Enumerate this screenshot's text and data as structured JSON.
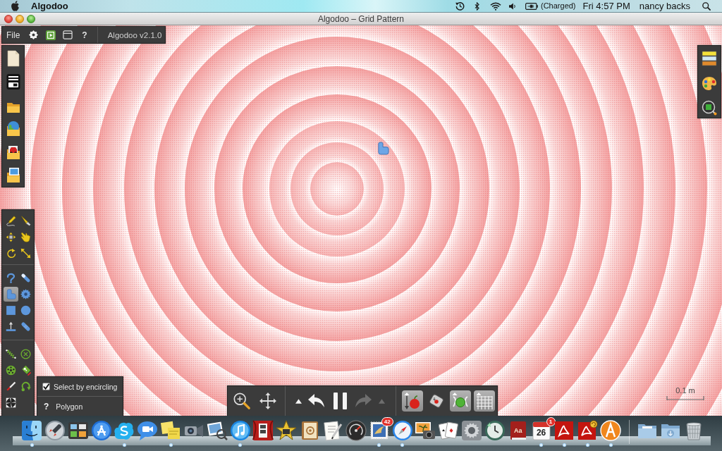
{
  "menu_bar": {
    "app_name": "Algodoo",
    "battery_status": "(Charged)",
    "clock": "Fri 4:57 PM",
    "user": "nancy backs"
  },
  "window": {
    "title": "Algodoo – Grid Pattern"
  },
  "file_bar": {
    "menu": "File",
    "help": "?",
    "version": "Algodoo v2.1.0"
  },
  "tool_palette": {
    "groups": [
      {
        "tools": [
          {
            "kind": "sketch",
            "selected": false
          },
          {
            "kind": "knife",
            "selected": false
          },
          {
            "kind": "move",
            "selected": false
          },
          {
            "kind": "drag",
            "selected": false
          },
          {
            "kind": "rotate",
            "selected": false
          },
          {
            "kind": "scale",
            "selected": false
          }
        ]
      },
      {
        "tools": [
          {
            "kind": "hook",
            "selected": false
          },
          {
            "kind": "brush",
            "selected": false
          },
          {
            "kind": "polygon",
            "selected": true
          },
          {
            "kind": "gear",
            "selected": false
          },
          {
            "kind": "box",
            "selected": false
          },
          {
            "kind": "circle",
            "selected": false
          },
          {
            "kind": "plane",
            "selected": false
          },
          {
            "kind": "capsule",
            "selected": false
          }
        ]
      },
      {
        "tools": [
          {
            "kind": "spring",
            "selected": false
          },
          {
            "kind": "axle",
            "selected": false
          },
          {
            "kind": "wheel",
            "selected": false
          },
          {
            "kind": "tag",
            "selected": false
          },
          {
            "kind": "pen",
            "selected": false
          },
          {
            "kind": "hinge",
            "selected": false
          },
          {
            "kind": "pinwheel",
            "selected": false
          }
        ]
      }
    ]
  },
  "options_panel": {
    "checkbox": {
      "label": "Select by encircling",
      "checked": true
    },
    "help": "?",
    "tool_name": "Polygon"
  },
  "simulation_bar": {
    "history": [
      {
        "kind": "caret",
        "disabled": false
      },
      {
        "kind": "undo",
        "disabled": false
      },
      {
        "kind": "pause",
        "disabled": false
      },
      {
        "kind": "redo",
        "disabled": true
      },
      {
        "kind": "caret",
        "disabled": true
      }
    ],
    "toggles": [
      {
        "kind": "gravity",
        "on": true
      },
      {
        "kind": "air",
        "on": false
      },
      {
        "kind": "collision",
        "on": true
      },
      {
        "kind": "grid",
        "on": true
      }
    ]
  },
  "scale_bar": {
    "label": "0.1 m"
  },
  "dock": {
    "items": [
      {
        "kind": "finder",
        "running": true
      },
      {
        "kind": "rocket",
        "running": false
      },
      {
        "kind": "windows",
        "running": false
      },
      {
        "kind": "appstore",
        "running": false
      },
      {
        "kind": "cloud",
        "running": true
      },
      {
        "kind": "bubble",
        "running": false
      },
      {
        "kind": "notes",
        "running": true
      },
      {
        "kind": "camera",
        "running": false
      },
      {
        "kind": "photos",
        "running": false
      },
      {
        "kind": "music",
        "running": true
      },
      {
        "kind": "booth",
        "running": false
      },
      {
        "kind": "star",
        "running": false
      },
      {
        "kind": "contacts",
        "running": false
      },
      {
        "kind": "textedit",
        "running": false
      },
      {
        "kind": "gauge",
        "running": false
      },
      {
        "kind": "stamp",
        "running": true,
        "badge": "42"
      },
      {
        "kind": "compass",
        "running": true
      },
      {
        "kind": "photocam",
        "running": false
      },
      {
        "kind": "cards",
        "running": false
      },
      {
        "kind": "gears",
        "running": false
      },
      {
        "kind": "clock",
        "running": false
      },
      {
        "kind": "dictionary",
        "running": false,
        "label": "Aa"
      },
      {
        "kind": "calendar",
        "running": true,
        "label": "26",
        "badge": "1"
      },
      {
        "kind": "swoosh",
        "running": true
      },
      {
        "kind": "swooshsync",
        "running": true
      },
      {
        "kind": "ashape",
        "running": true
      }
    ],
    "stacks": [
      {
        "kind": "folder",
        "running": false
      },
      {
        "kind": "downloads",
        "running": false
      },
      {
        "kind": "trash",
        "running": false
      }
    ]
  }
}
